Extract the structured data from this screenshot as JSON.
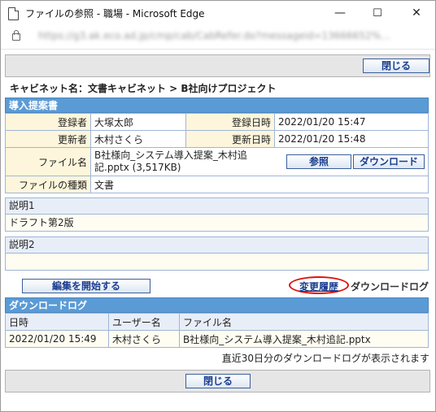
{
  "window": {
    "title": "ファイルの参照 - 職場 - Microsoft Edge",
    "url": "https://g3.ak.eco.ad.jp/cmp/cab/CabRefer.do?messageid=13666652%…",
    "minimize": "—",
    "maximize": "☐",
    "close": "✕"
  },
  "toolbar": {
    "close_top": "閉じる",
    "close_bottom": "閉じる"
  },
  "breadcrumb": "キャビネット名：文書キャビネット > B社向けプロジェクト",
  "document": {
    "section_title": "導入提案書",
    "registrant_label": "登録者",
    "registrant": "大塚太郎",
    "registered_at_label": "登録日時",
    "registered_at": "2022/01/20 15:47",
    "updater_label": "更新者",
    "updater": "木村さくら",
    "updated_at_label": "更新日時",
    "updated_at": "2022/01/20 15:48",
    "filename_label": "ファイル名",
    "filename_line1": "B社様向_システム導入提案_木村追",
    "filename_line2": "記.pptx (3,517KB)",
    "browse_button": "参照",
    "download_button": "ダウンロード",
    "filetype_label": "ファイルの種類",
    "filetype": "文書"
  },
  "description1": {
    "label": "説明1",
    "value": "ドラフト第2版"
  },
  "description2": {
    "label": "説明2",
    "value": ""
  },
  "actions": {
    "edit_button": "編集を開始する",
    "history_link": "変更履歴",
    "download_log_link": "ダウンロードログ"
  },
  "download_log": {
    "title": "ダウンロードログ",
    "columns": [
      "日時",
      "ユーザー名",
      "ファイル名"
    ],
    "rows": [
      [
        "2022/01/20 15:49",
        "木村さくら",
        "B社様向_システム導入提案_木村追記.pptx"
      ]
    ],
    "note": "直近30日分のダウンロードログが表示されます"
  },
  "colors": {
    "accent": "#5b9bd5",
    "label_bg": "#fdf6dc",
    "highlight": "#dd1111"
  }
}
